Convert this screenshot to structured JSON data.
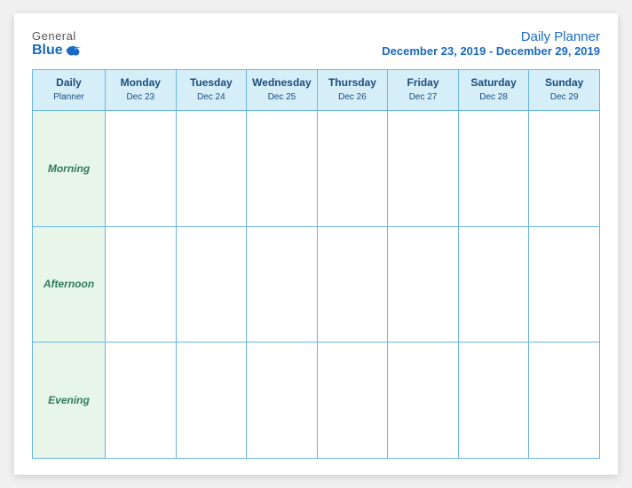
{
  "logo": {
    "general": "General",
    "blue": "Blue"
  },
  "title": {
    "main": "Daily Planner",
    "dates": "December 23, 2019 - December 29, 2019"
  },
  "header_row": {
    "col0": {
      "name": "Daily",
      "sub": "Planner"
    },
    "col1": {
      "name": "Monday",
      "sub": "Dec 23"
    },
    "col2": {
      "name": "Tuesday",
      "sub": "Dec 24"
    },
    "col3": {
      "name": "Wednesday",
      "sub": "Dec 25"
    },
    "col4": {
      "name": "Thursday",
      "sub": "Dec 26"
    },
    "col5": {
      "name": "Friday",
      "sub": "Dec 27"
    },
    "col6": {
      "name": "Saturday",
      "sub": "Dec 28"
    },
    "col7": {
      "name": "Sunday",
      "sub": "Dec 29"
    }
  },
  "rows": [
    {
      "label": "Morning"
    },
    {
      "label": "Afternoon"
    },
    {
      "label": "Evening"
    }
  ]
}
